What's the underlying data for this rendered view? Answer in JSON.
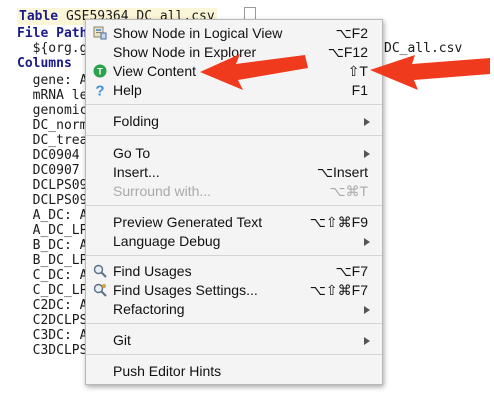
{
  "editor": {
    "title_keyword": "Table",
    "title_rest": "GSE59364_DC_all.csv",
    "lines": [
      {
        "kw": "File Path",
        "text": ""
      },
      {
        "kw": "",
        "text": "  ${org.g"
      },
      {
        "kw": "Columns",
        "text": ""
      },
      {
        "kw": "",
        "text": "  gene: A"
      },
      {
        "kw": "",
        "text": "  mRNA le"
      },
      {
        "kw": "",
        "text": "  genomic"
      },
      {
        "kw": "",
        "text": "  DC_norm"
      },
      {
        "kw": "",
        "text": "  DC_trea"
      },
      {
        "kw": "",
        "text": "  DC0904"
      },
      {
        "kw": "",
        "text": "  DC0907"
      },
      {
        "kw": "",
        "text": "  DCLPS09"
      },
      {
        "kw": "",
        "text": "  DCLPS09"
      },
      {
        "kw": "",
        "text": "  A_DC: A"
      },
      {
        "kw": "",
        "text": "  A_DC_LP"
      },
      {
        "kw": "",
        "text": "  B_DC: A"
      },
      {
        "kw": "",
        "text": "  B_DC_LP"
      },
      {
        "kw": "",
        "text": "  C_DC: A"
      },
      {
        "kw": "",
        "text": "  C_DC_LP"
      },
      {
        "kw": "",
        "text": "  C2DC: A"
      },
      {
        "kw": "",
        "text": "  C2DCLPS"
      },
      {
        "kw": "",
        "text": "  C3DC: A"
      },
      {
        "kw": "",
        "text": "  C3DCLPS"
      }
    ],
    "right_fragment": "DC_all.csv"
  },
  "menu": {
    "items": [
      {
        "label": "Show Node in Logical View",
        "shortcut": "⌥F2",
        "icon": "logical-view-icon"
      },
      {
        "label": "Show Node in Explorer",
        "shortcut": "⌥F12",
        "icon": ""
      },
      {
        "label": "View Content",
        "shortcut": "⇧T",
        "icon": "view-content-icon"
      },
      {
        "label": "Help",
        "shortcut": "F1",
        "icon": "help-icon"
      },
      {
        "label": "Folding",
        "submenu": true
      },
      {
        "label": "Go To",
        "submenu": true
      },
      {
        "label": "Insert...",
        "shortcut": "⌥Insert"
      },
      {
        "label": "Surround with...",
        "shortcut": "⌥⌘T",
        "disabled": true
      },
      {
        "label": "Preview Generated Text",
        "shortcut": "⌥⇧⌘F9"
      },
      {
        "label": "Language Debug",
        "submenu": true
      },
      {
        "label": "Find Usages",
        "shortcut": "⌥F7",
        "icon": "find-usages-icon"
      },
      {
        "label": "Find Usages Settings...",
        "shortcut": "⌥⇧⌘F7",
        "icon": "find-usages-settings-icon"
      },
      {
        "label": "Refactoring",
        "submenu": true
      },
      {
        "label": "Git",
        "submenu": true
      },
      {
        "label": "Push Editor Hints"
      }
    ]
  },
  "colors": {
    "annotation_arrow": "#f03a1e",
    "view_content_icon": "#2aa14a",
    "help_icon": "#3d8fd8"
  }
}
